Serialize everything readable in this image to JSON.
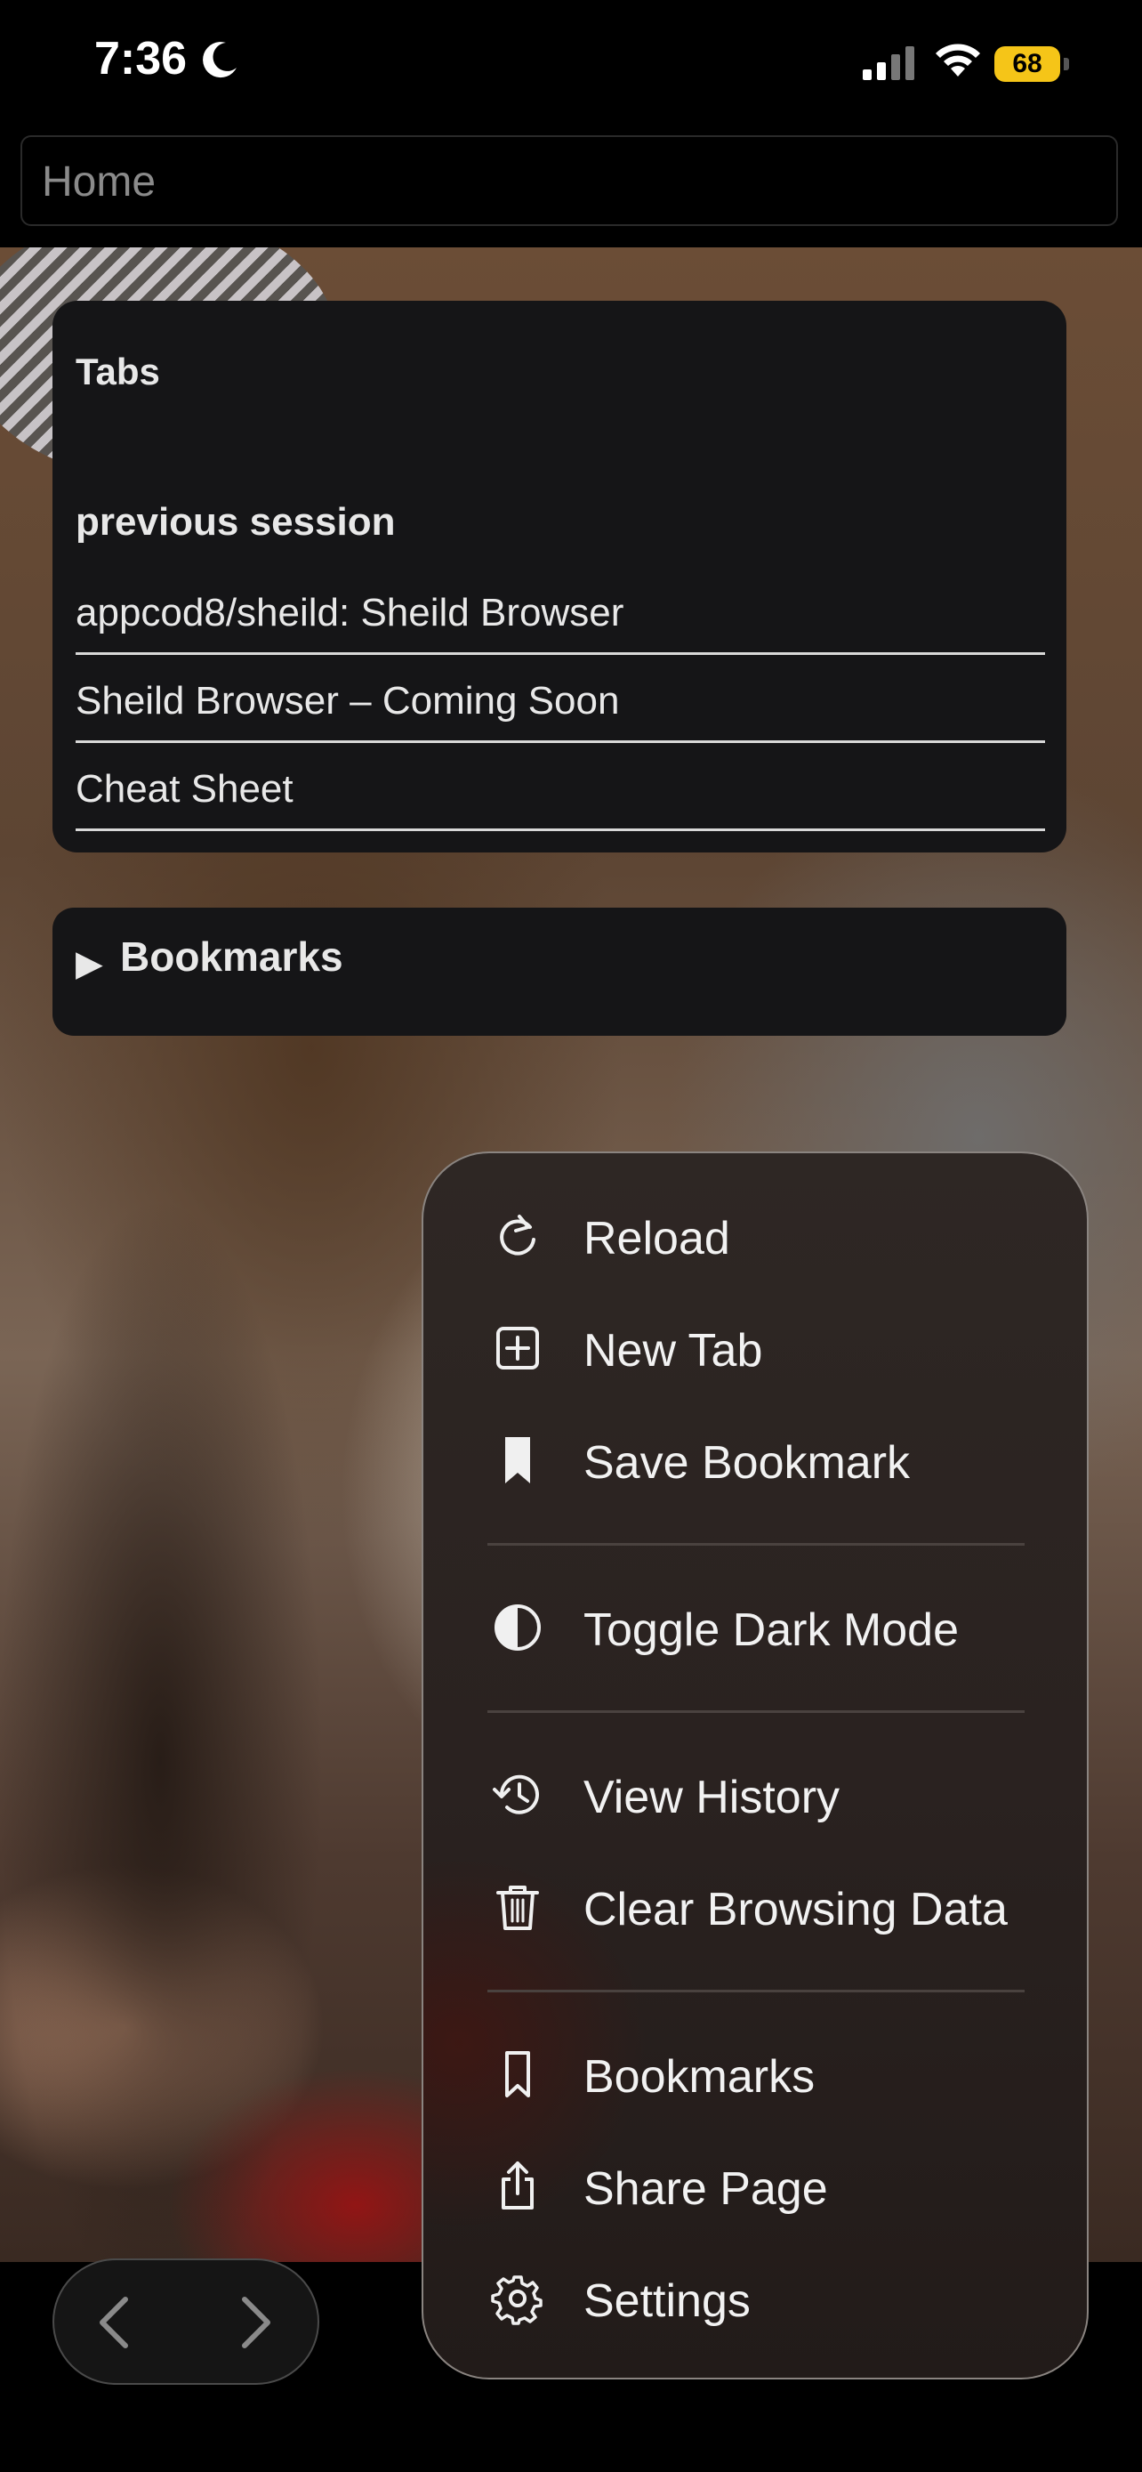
{
  "status_bar": {
    "time": "7:36",
    "battery_level": "68",
    "battery_color": "#f5c518"
  },
  "address_bar": {
    "placeholder": "Home"
  },
  "tabs_panel": {
    "title": "Tabs",
    "session_title": "previous session",
    "session_items": [
      "appcod8/sheild: Sheild Browser",
      "Sheild Browser – Coming Soon",
      "Cheat Sheet"
    ]
  },
  "bookmarks_panel": {
    "toggle_glyph": "▶",
    "label": "Bookmarks"
  },
  "menu": {
    "items": [
      {
        "label": "Reload",
        "icon": "reload-icon"
      },
      {
        "label": "New Tab",
        "icon": "plus-square-icon"
      },
      {
        "label": "Save Bookmark",
        "icon": "bookmark-filled-icon"
      },
      {
        "label": "Toggle Dark Mode",
        "icon": "half-circle-icon"
      },
      {
        "label": "View History",
        "icon": "history-icon"
      },
      {
        "label": "Clear Browsing Data",
        "icon": "trash-icon"
      },
      {
        "label": "Bookmarks",
        "icon": "bookmark-outline-icon"
      },
      {
        "label": "Share Page",
        "icon": "share-icon"
      },
      {
        "label": "Settings",
        "icon": "gear-icon"
      }
    ]
  },
  "nav": {
    "back_icon": "chevron-left-icon",
    "forward_icon": "chevron-right-icon"
  }
}
